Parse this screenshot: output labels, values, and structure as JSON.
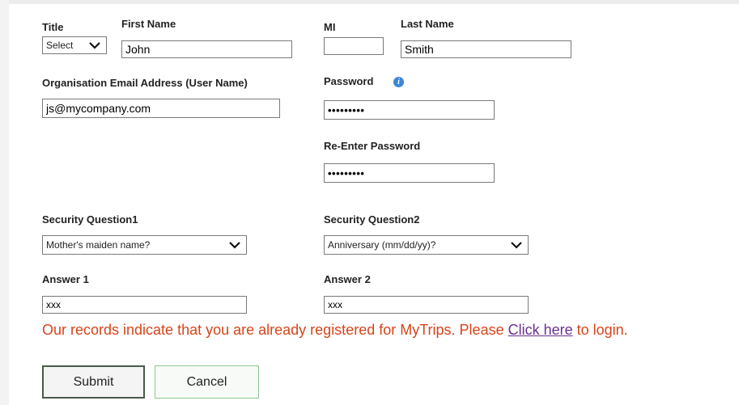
{
  "form": {
    "title_label": "Title",
    "title_select": "Select",
    "first_name_label": "First Name",
    "first_name_value": "John",
    "mi_label": "MI",
    "mi_value": "",
    "last_name_label": "Last Name",
    "last_name_value": "Smith",
    "email_label": "Organisation Email Address (User Name)",
    "email_value": "js@mycompany.com",
    "password_label": "Password",
    "password_value": "•••••••••",
    "reenter_label": "Re-Enter Password",
    "reenter_value": "•••••••••",
    "sq1_label": "Security Question1",
    "sq1_value": "Mother's maiden name?",
    "sq2_label": "Security Question2",
    "sq2_value": "Anniversary (mm/dd/yy)?",
    "answer1_label": "Answer 1",
    "answer1_value": "xxx",
    "answer2_label": "Answer 2",
    "answer2_value": "xxx"
  },
  "message": {
    "before": "Our records indicate that you are already registered for MyTrips. Please ",
    "link": "Click here",
    "after": " to login."
  },
  "buttons": {
    "submit": "Submit",
    "cancel": "Cancel"
  },
  "icons": {
    "info": "info-icon",
    "dropdown": "chevron-down-icon"
  },
  "colors": {
    "error_text": "#d8441a",
    "link": "#6a2f8e",
    "info_icon": "#3b86d8",
    "cancel_border": "#8fc88f"
  }
}
